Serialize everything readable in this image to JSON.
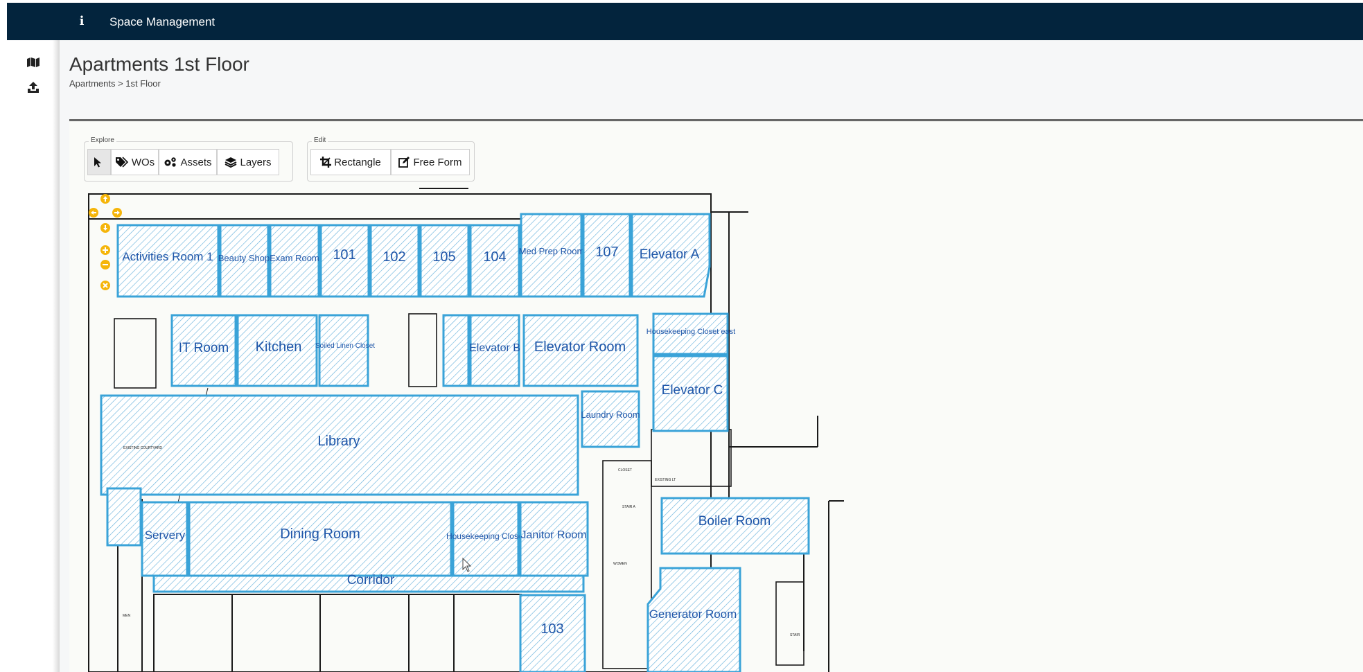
{
  "header": {
    "app_title": "Space Management",
    "info_icon": "info-icon"
  },
  "left_rail": {
    "items": [
      {
        "icon": "map-icon"
      },
      {
        "icon": "upload-icon"
      }
    ]
  },
  "page": {
    "title": "Apartments 1st Floor",
    "breadcrumb": "Apartments > 1st Floor"
  },
  "toolbar": {
    "explore_label": "Explore",
    "edit_label": "Edit",
    "explore_buttons": [
      {
        "icon": "pointer-icon",
        "label": ""
      },
      {
        "icon": "tags-icon",
        "label": "WOs"
      },
      {
        "icon": "gears-icon",
        "label": "Assets"
      },
      {
        "icon": "layers-icon",
        "label": "Layers"
      }
    ],
    "edit_buttons": [
      {
        "icon": "crop-icon",
        "label": "Rectangle"
      },
      {
        "icon": "edit-icon",
        "label": "Free Form"
      }
    ]
  },
  "map_controls": [
    "pan-up",
    "pan-left",
    "pan-right",
    "pan-down",
    "zoom-in",
    "zoom-out",
    "reset"
  ],
  "floorplan": {
    "rooms": [
      "Activities Room 1",
      "Beauty Shop",
      "Exam Room",
      "101",
      "102",
      "105",
      "104",
      "Med Prep Room",
      "107",
      "Elevator A",
      "IT Room",
      "Kitchen",
      "Soiled Linen Closet",
      "Elevator B",
      "Elevator Room",
      "Housekeeping Closet east",
      "Elevator C",
      "Laundry Room",
      "Library",
      "Servery",
      "Dining Room",
      "Housekeeping Closet",
      "Janitor Room",
      "Boiler Room",
      "Corridor",
      "103",
      "Generator Room"
    ],
    "small_labels": [
      "EXISTING COURTYARD",
      "EXISTING LT",
      "CLOSET",
      "STAIR A",
      "WOMEN",
      "MEN",
      "STAIR"
    ]
  },
  "colors": {
    "header_bg": "#03243d",
    "room_outline": "#3aa3d8",
    "room_label": "#1e55a8",
    "map_control": "#f5b50a"
  }
}
